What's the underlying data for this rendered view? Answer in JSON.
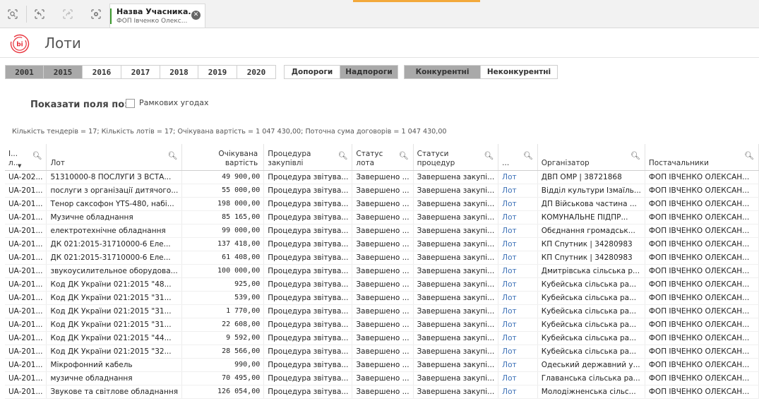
{
  "toolbar": {
    "tab_title": "Назва Учасника...",
    "tab_subtitle": "ФОП Івченко Олекс...",
    "icons": [
      "search-icon",
      "back-icon",
      "forward-icon",
      "clear-selections-icon",
      "close-icon"
    ]
  },
  "page": {
    "title": "Лоти",
    "logo": "bi"
  },
  "years": [
    {
      "label": "2001",
      "selected": true
    },
    {
      "label": "2015",
      "selected": true
    },
    {
      "label": "2016",
      "selected": false
    },
    {
      "label": "2017",
      "selected": false
    },
    {
      "label": "2018",
      "selected": false
    },
    {
      "label": "2019",
      "selected": false
    },
    {
      "label": "2020",
      "selected": false
    }
  ],
  "thresholds": [
    {
      "label": "Допороги",
      "selected": false
    },
    {
      "label": "Надпороги",
      "selected": true
    }
  ],
  "competition": [
    {
      "label": "Конкурентні",
      "selected": true
    },
    {
      "label": "Неконкурентні",
      "selected": false
    }
  ],
  "show_fields": {
    "label": "Показати поля по:",
    "checkbox_label": "Рамкових угодах",
    "checked": false
  },
  "summary": "Кількість тендерів = 17; Кількість лотів = 17; Очікувана вартість = 1 047 430,00; Поточна сума договорів = 1 047 430,00",
  "columns": [
    "І... л...",
    "Лот",
    "Очікувана вартість",
    "Процедура закупівлі",
    "Статус лота",
    "Статуси процедур",
    "...",
    "Організатор",
    "Постачальники"
  ],
  "rows": [
    [
      "UA-202...",
      "51310000-8 ПОСЛУГИ З ВСТА...",
      "49 900,00",
      "Процедура звітува...",
      "Завершено ...",
      "Завершена закупі...",
      "Лот",
      "ДВП ОМР | 38721868",
      "ФОП ІВЧЕНКО ОЛЕКСАН..."
    ],
    [
      "UA-201...",
      "послуги з організації дитячого...",
      "55 000,00",
      "Процедура звітува...",
      "Завершено ...",
      "Завершена закупі...",
      "Лот",
      "Відділ культури Ізмаїль...",
      "ФОП ІВЧЕНКО ОЛЕКСАН..."
    ],
    [
      "UA-201...",
      "Тенор саксофон YTS-480, набі...",
      "198 000,00",
      "Процедура звітува...",
      "Завершено ...",
      "Завершена закупі...",
      "Лот",
      "ДП Військова частина ...",
      "ФОП ІВЧЕНКО ОЛЕКСАН..."
    ],
    [
      "UA-201...",
      "Музичне обладнання",
      "85 165,00",
      "Процедура звітува...",
      "Завершено ...",
      "Завершена закупі...",
      "Лот",
      "КОМУНАЛЬНЕ ПІДПР...",
      "ФОП ІВЧЕНКО ОЛЕКСАН..."
    ],
    [
      "UA-201...",
      "електротехнічне обладнання",
      "99 000,00",
      "Процедура звітува...",
      "Завершено ...",
      "Завершена закупі...",
      "Лот",
      "Обєднання громадськ...",
      "ФОП ІВЧЕНКО ОЛЕКСАН..."
    ],
    [
      "UA-201...",
      "ДК 021:2015-31710000-6 Еле...",
      "137 418,00",
      "Процедура звітува...",
      "Завершено ...",
      "Завершена закупі...",
      "Лот",
      "КП Спутник | 34280983",
      "ФОП ІВЧЕНКО ОЛЕКСАН..."
    ],
    [
      "UA-201...",
      "ДК 021:2015-31710000-6 Еле...",
      "61 408,00",
      "Процедура звітува...",
      "Завершено ...",
      "Завершена закупі...",
      "Лот",
      "КП Спутник | 34280983",
      "ФОП ІВЧЕНКО ОЛЕКСАН..."
    ],
    [
      "UA-201...",
      "звукоусилительное оборудова...",
      "100 000,00",
      "Процедура звітува...",
      "Завершено ...",
      "Завершена закупі...",
      "Лот",
      "Дмитрівська сільська р...",
      "ФОП ІВЧЕНКО ОЛЕКСАН..."
    ],
    [
      "UA-201...",
      "Код ДК України 021:2015 \"48...",
      "925,00",
      "Процедура звітува...",
      "Завершено ...",
      "Завершена закупі...",
      "Лот",
      "Кубейська сільська ра...",
      "ФОП ІВЧЕНКО ОЛЕКСАН..."
    ],
    [
      "UA-201...",
      "Код ДК України 021:2015 \"31...",
      "539,00",
      "Процедура звітува...",
      "Завершено ...",
      "Завершена закупі...",
      "Лот",
      "Кубейська сільська ра...",
      "ФОП ІВЧЕНКО ОЛЕКСАН..."
    ],
    [
      "UA-201...",
      "Код ДК України 021:2015 \"31...",
      "1 770,00",
      "Процедура звітува...",
      "Завершено ...",
      "Завершена закупі...",
      "Лот",
      "Кубейська сільська ра...",
      "ФОП ІВЧЕНКО ОЛЕКСАН..."
    ],
    [
      "UA-201...",
      "Код ДК України 021:2015 \"31...",
      "22 608,00",
      "Процедура звітува...",
      "Завершено ...",
      "Завершена закупі...",
      "Лот",
      "Кубейська сільська ра...",
      "ФОП ІВЧЕНКО ОЛЕКСАН..."
    ],
    [
      "UA-201...",
      "Код ДК України 021:2015 \"44...",
      "9 592,00",
      "Процедура звітува...",
      "Завершено ...",
      "Завершена закупі...",
      "Лот",
      "Кубейська сільська ра...",
      "ФОП ІВЧЕНКО ОЛЕКСАН..."
    ],
    [
      "UA-201...",
      "Код ДК України 021:2015 \"32...",
      "28 566,00",
      "Процедура звітува...",
      "Завершено ...",
      "Завершена закупі...",
      "Лот",
      "Кубейська сільська ра...",
      "ФОП ІВЧЕНКО ОЛЕКСАН..."
    ],
    [
      "UA-201...",
      "Мікрофонний кабель",
      "990,00",
      "Процедура звітува...",
      "Завершено ...",
      "Завершена закупі...",
      "Лот",
      "Одеський державний у...",
      "ФОП ІВЧЕНКО ОЛЕКСАН..."
    ],
    [
      "UA-201...",
      "музичне обладнання",
      "70 495,00",
      "Процедура звітува...",
      "Завершено ...",
      "Завершена закупі...",
      "Лот",
      "Главанська сільська ра...",
      "ФОП ІВЧЕНКО ОЛЕКСАН..."
    ],
    [
      "UA-201...",
      "Звукове та світлове обладнання",
      "126 054,00",
      "Процедура звітува...",
      "Завершено ...",
      "Завершена закупі...",
      "Лот",
      "Молодіжненська сільс...",
      "ФОП ІВЧЕНКО ОЛЕКСАН..."
    ]
  ]
}
